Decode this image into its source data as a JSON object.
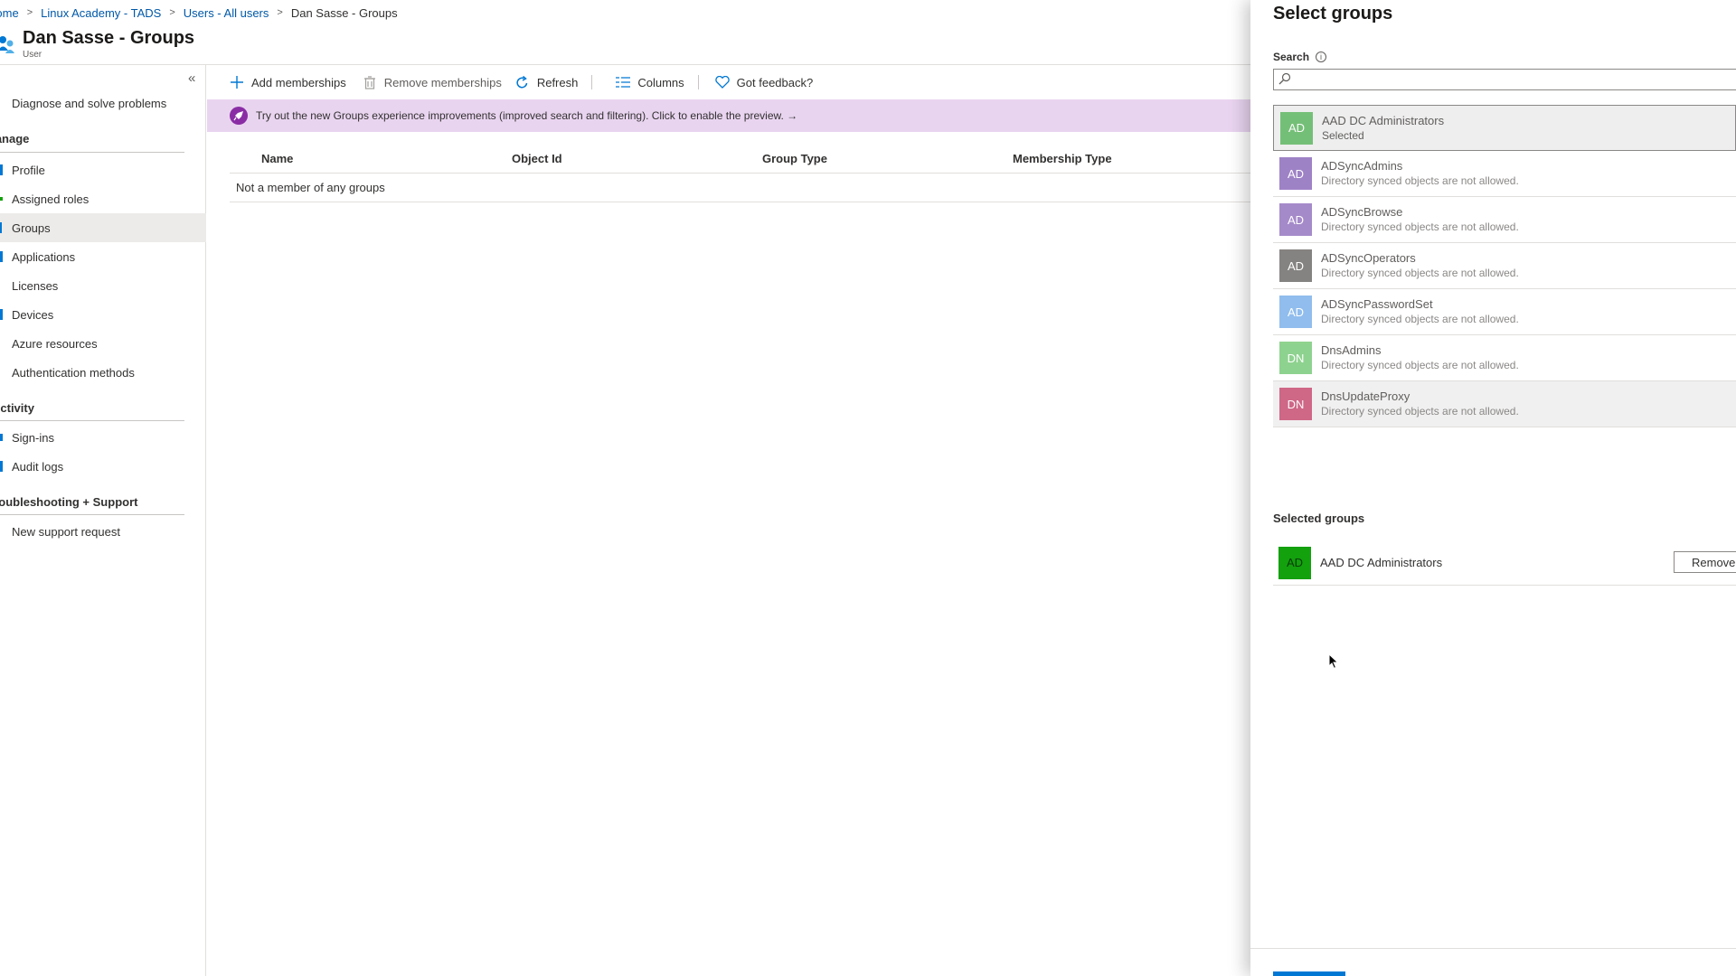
{
  "breadcrumb": {
    "items": [
      "Home",
      "Linux Academy - TADS",
      "Users - All users"
    ],
    "current": "Dan Sasse - Groups"
  },
  "header": {
    "title": "Dan Sasse - Groups",
    "subtitle": "User"
  },
  "sidebar": {
    "items": [
      {
        "label": "Diagnose and solve problems"
      },
      {
        "label": "Profile"
      },
      {
        "label": "Assigned roles"
      },
      {
        "label": "Groups"
      },
      {
        "label": "Applications"
      },
      {
        "label": "Licenses"
      },
      {
        "label": "Devices"
      },
      {
        "label": "Azure resources"
      },
      {
        "label": "Authentication methods"
      },
      {
        "label": "Sign-ins"
      },
      {
        "label": "Audit logs"
      },
      {
        "label": "New support request"
      }
    ],
    "sections": [
      "Manage",
      "Activity",
      "Troubleshooting + Support"
    ],
    "active": "Groups"
  },
  "toolbar": {
    "add_memberships": "Add memberships",
    "remove_memberships": "Remove memberships",
    "refresh": "Refresh",
    "columns": "Columns",
    "feedback": "Got feedback?"
  },
  "banner": {
    "text": "Try out the new Groups experience improvements (improved search and filtering). Click to enable the preview. →"
  },
  "table": {
    "columns": [
      "Name",
      "Object Id",
      "Group Type",
      "Membership Type"
    ],
    "empty_message": "Not a member of any groups"
  },
  "blade": {
    "title": "Select groups",
    "search_label": "Search",
    "search_value": "",
    "groups": [
      {
        "initials": "AD",
        "name": "AAD DC Administrators",
        "status": "Selected",
        "color": "#4cb050"
      },
      {
        "initials": "AD",
        "name": "ADSyncAdmins",
        "status": "Directory synced objects are not allowed.",
        "color": "#8764b8"
      },
      {
        "initials": "AD",
        "name": "ADSyncBrowse",
        "status": "Directory synced objects are not allowed.",
        "color": "#8764b8"
      },
      {
        "initials": "AD",
        "name": "ADSyncOperators",
        "status": "Directory synced objects are not allowed.",
        "color": "#5d5a58"
      },
      {
        "initials": "AD",
        "name": "ADSyncPasswordSet",
        "status": "Directory synced objects are not allowed.",
        "color": "#6ba8e8"
      },
      {
        "initials": "DN",
        "name": "DnsAdmins",
        "status": "Directory synced objects are not allowed.",
        "color": "#5fc060"
      },
      {
        "initials": "DN",
        "name": "DnsUpdateProxy",
        "status": "Directory synced objects are not allowed.",
        "color": "#c8466e"
      }
    ],
    "selected_header": "Selected groups",
    "selected": [
      {
        "initials": "AD",
        "name": "AAD DC Administrators",
        "color": "#13a10e"
      }
    ],
    "remove_label": "Remove"
  }
}
